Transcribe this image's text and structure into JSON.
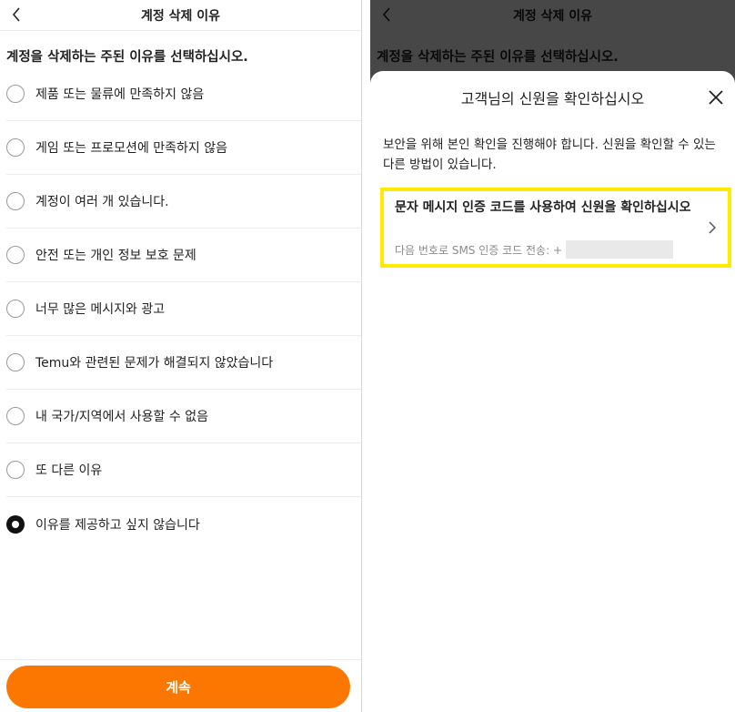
{
  "screen": {
    "title": "계정 삭제 이유",
    "prompt": "계정을 삭제하는 주된 이유를 선택하십시오.",
    "options": [
      {
        "label": "제품 또는 물류에 만족하지 않음",
        "selected": false
      },
      {
        "label": "게임 또는 프로모션에 만족하지 않음",
        "selected": false
      },
      {
        "label": "계정이 여러 개 있습니다.",
        "selected": false
      },
      {
        "label": "안전 또는 개인 정보 보호 문제",
        "selected": false
      },
      {
        "label": "너무 많은 메시지와 광고",
        "selected": false
      },
      {
        "label": "Temu와 관련된 문제가 해결되지 않았습니다",
        "selected": false
      },
      {
        "label": "내 국가/지역에서 사용할 수 없음",
        "selected": false
      },
      {
        "label": "또 다른 이유",
        "selected": false
      },
      {
        "label": "이유를 제공하고 싶지 않습니다",
        "selected": true
      }
    ],
    "continue_label": "계속"
  },
  "modal": {
    "title": "고객님의 신원을 확인하십시오",
    "description": "보안을 위해 본인 확인을 진행해야 합니다. 신원을 확인할 수 있는 다른 방법이 있습니다.",
    "method": {
      "title": "문자 메시지 인증 코드를 사용하여 신원을 확인하십시오",
      "subtitle": "다음 번호로 SMS 인증 코드 전송: +"
    }
  },
  "icons": {
    "back": "chevron-left-icon",
    "close": "close-icon",
    "chevron": "chevron-right-icon"
  },
  "colors": {
    "accent": "#fb7701",
    "highlight": "#ffea00"
  }
}
